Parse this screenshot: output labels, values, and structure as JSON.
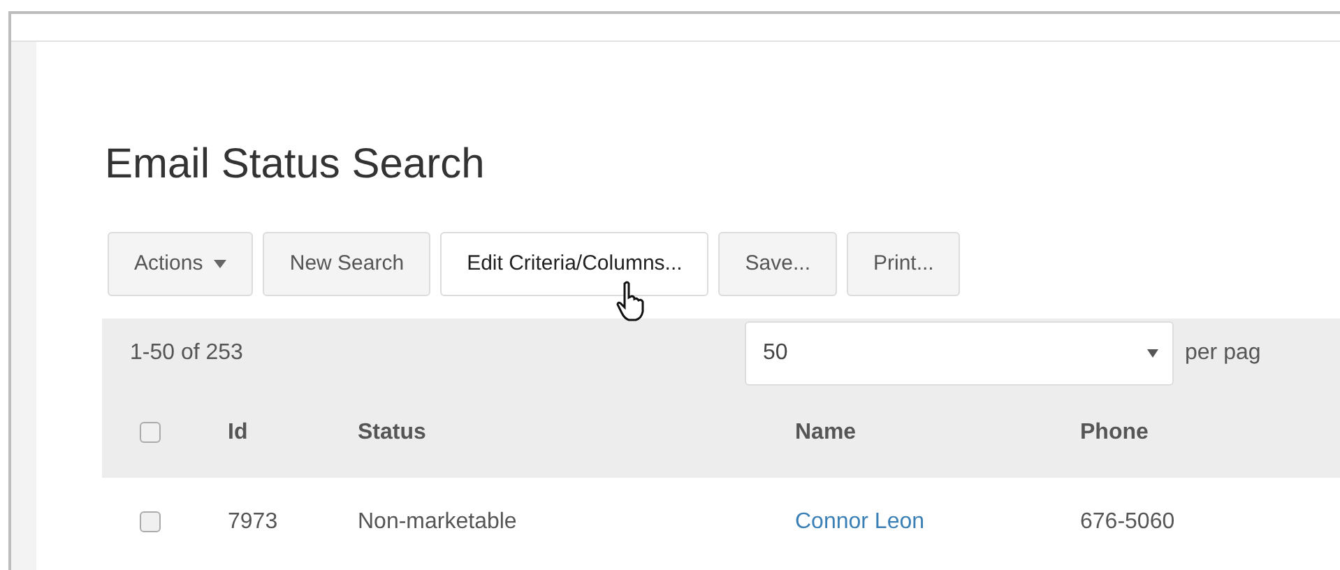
{
  "page": {
    "title": "Email Status Search"
  },
  "toolbar": [
    {
      "label": "Actions",
      "kind": "dropdown",
      "hovered": false
    },
    {
      "label": "New Search",
      "kind": "button",
      "hovered": false
    },
    {
      "label": "Edit Criteria/Columns...",
      "kind": "button",
      "hovered": true
    },
    {
      "label": "Save...",
      "kind": "button",
      "hovered": false
    },
    {
      "label": "Print...",
      "kind": "button",
      "hovered": false
    }
  ],
  "pager": {
    "range": "1-50 of 253",
    "page_size": "50",
    "suffix": "per pag"
  },
  "table": {
    "select_all": {
      "checked": false
    },
    "columns": [
      "Id",
      "Status",
      "Name",
      "Phone"
    ],
    "rows": [
      {
        "checked": false,
        "id": "7973",
        "status": "Non-marketable",
        "name": "Connor Leon",
        "phone": "676-5060"
      }
    ]
  }
}
